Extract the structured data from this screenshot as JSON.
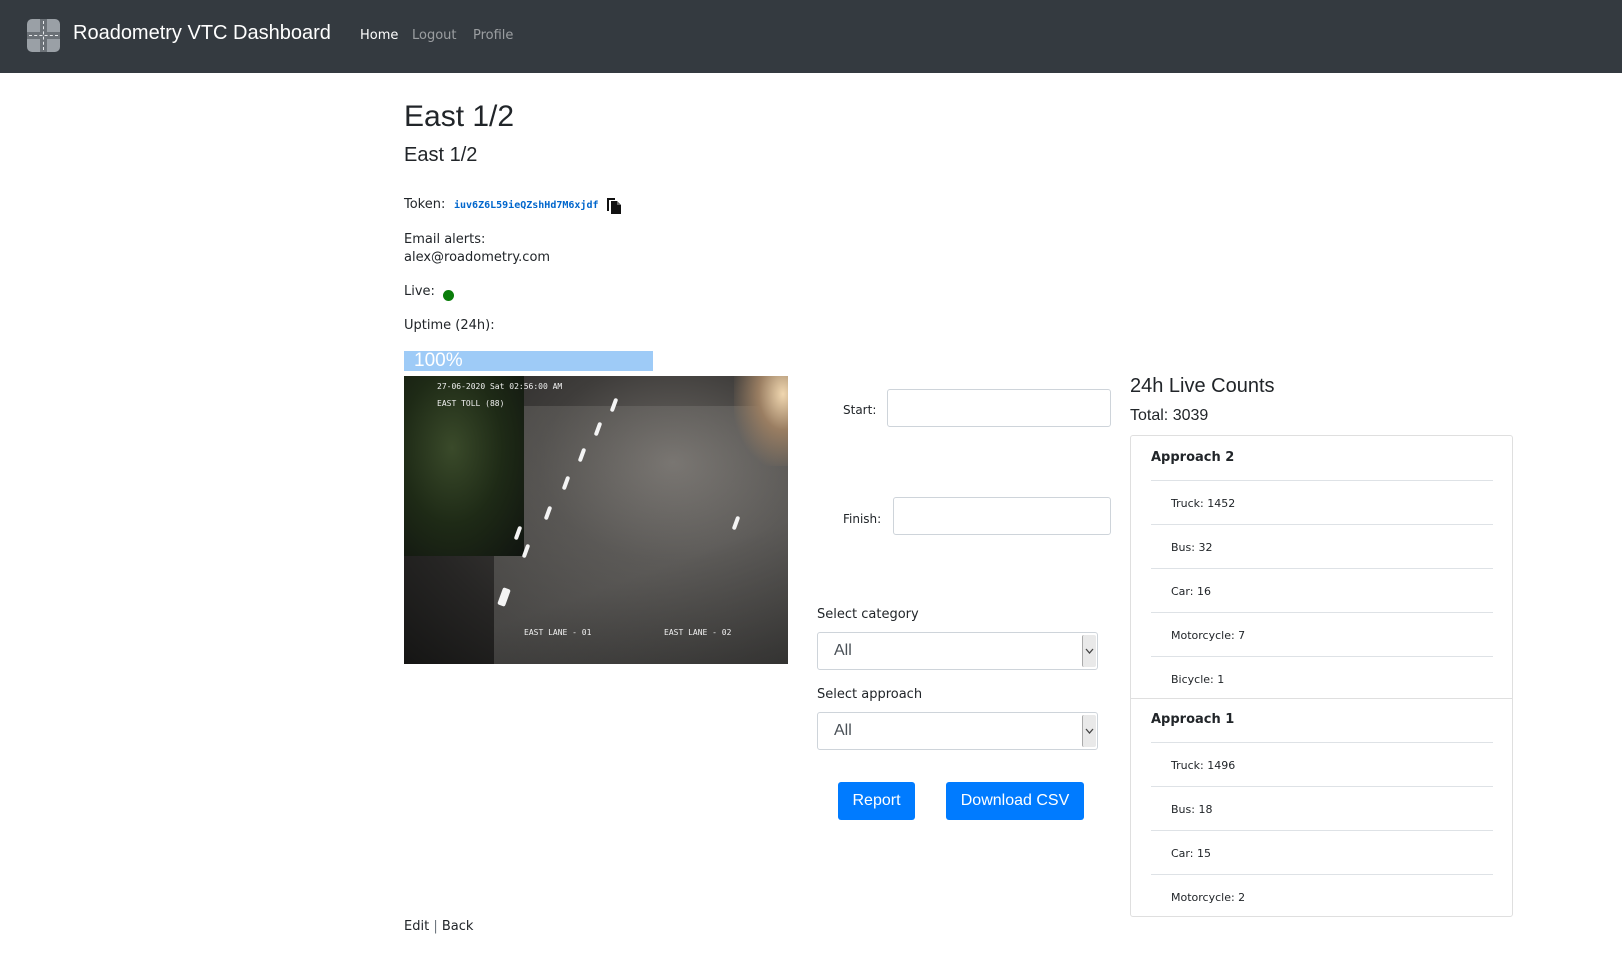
{
  "navbar": {
    "brand": "Roadometry VTC Dashboard",
    "links": [
      {
        "label": "Home",
        "active": true
      },
      {
        "label": "Logout",
        "active": false
      },
      {
        "label": "Profile",
        "active": false
      }
    ],
    "background": "#343a40"
  },
  "site": {
    "title": "East 1/2",
    "subtitle": "East 1/2"
  },
  "details": {
    "token_label": "Token:",
    "token_value": "iuv6Z6L59ieQZshHd7M6xjdf",
    "copy_icon": "copy-icon",
    "email_label": "Email alerts:",
    "email_value": "alex@roadometry.com",
    "live_label": "Live:",
    "live_status_color": "#0a7d0a",
    "uptime_label": "Uptime (24h):",
    "uptime_text": "100%",
    "uptime_fraction": 1.0
  },
  "camera": {
    "overlay_datetime": "27-06-2020 Sat 02:56:00 AM",
    "overlay_location": "EAST TOLL (88)",
    "lane_1": "EAST LANE - 01",
    "lane_2": "EAST LANE - 02"
  },
  "form": {
    "start_label": "Start:",
    "start_value": "",
    "finish_label": "Finish:",
    "finish_value": "",
    "category_label": "Select category",
    "category_value": "All",
    "approach_label": "Select approach",
    "approach_value": "All",
    "report_button": "Report",
    "csv_button": "Download CSV",
    "accent": "#007bff"
  },
  "counts": {
    "title": "24h Live Counts",
    "total": "Total: 3039",
    "approaches": [
      {
        "name": "Approach 2",
        "items": [
          "Truck: 1452",
          "Bus: 32",
          "Car: 16",
          "Motorcycle: 7",
          "Bicycle: 1"
        ]
      },
      {
        "name": "Approach 1",
        "items": [
          "Truck: 1496",
          "Bus: 18",
          "Car: 15",
          "Motorcycle: 2"
        ]
      }
    ]
  },
  "footer": {
    "edit": "Edit",
    "separator": "|",
    "back": "Back"
  }
}
